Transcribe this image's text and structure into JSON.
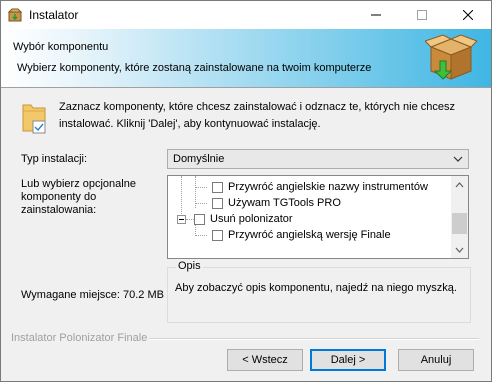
{
  "window": {
    "title": "Instalator",
    "minimize_icon": "minimize-icon",
    "maximize_icon": "maximize-icon",
    "close_icon": "close-icon"
  },
  "header": {
    "title": "Wybór komponentu",
    "subtitle": "Wybierz komponenty, które zostaną zainstalowane na twoim komputerze",
    "logo_icon": "package-box-icon"
  },
  "intro": {
    "icon": "folder-icon",
    "text": "Zaznacz komponenty, które chcesz zainstalować i odznacz te, których nie chcesz instalować. Kliknij 'Dalej', aby kontynuować instalację."
  },
  "install_type": {
    "label": "Typ instalacji:",
    "selected": "Domyślnie"
  },
  "components": {
    "label": "Lub wybierz opcjonalne komponenty do zainstalowania:",
    "items": [
      {
        "label": "Przywróć angielskie nazwy instrumentów",
        "checked": false
      },
      {
        "label": "Używam TGTools PRO",
        "checked": false
      },
      {
        "label": "Usuń polonizator",
        "checked": false,
        "expanded": true
      },
      {
        "label": "Przywróć angielską wersję Finale",
        "checked": false
      }
    ]
  },
  "space": {
    "text": "Wymagane miejsce: 70.2 MB"
  },
  "description": {
    "title": "Opis",
    "text": "Aby zobaczyć opis komponentu, najedź na niego myszką."
  },
  "footer": {
    "brand": "Instalator Polonizator Finale",
    "back": "< Wstecz",
    "next": "Dalej >",
    "cancel": "Anuluj"
  },
  "colors": {
    "header_gradient_end": "#3fb6e3",
    "accent": "#0078d7"
  }
}
